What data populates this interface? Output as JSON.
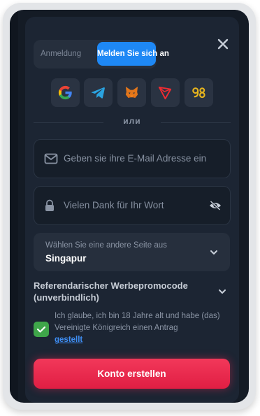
{
  "tabs": {
    "login_label": "Anmeldung",
    "register_label": "Melden Sie sich an"
  },
  "social": [
    "google-icon",
    "telegram-icon",
    "metamask-icon",
    "tron-icon",
    "ninety-eight-icon"
  ],
  "divider_text": "или",
  "email": {
    "placeholder": "Geben sie ihre E-Mail Adresse ein"
  },
  "password": {
    "placeholder": "Vielen Dank für Ihr Wort"
  },
  "country": {
    "label": "Wählen Sie eine andere Seite aus",
    "value": "Singapur"
  },
  "promo": {
    "label": "Referendarischer Werbepromocode (unverbindlich)"
  },
  "agreement": {
    "text": "Ich glaube, ich bin 18 Jahre alt und habe (das) Vereinigte Königreich einen Antrag",
    "link": "gestellt",
    "checked": true
  },
  "submit_label": "Konto erstellen",
  "colors": {
    "accent_blue": "#1e88f5",
    "submit_red": "#e8264a",
    "checkbox_green": "#3fa64a",
    "modal_bg": "#1c2533"
  }
}
